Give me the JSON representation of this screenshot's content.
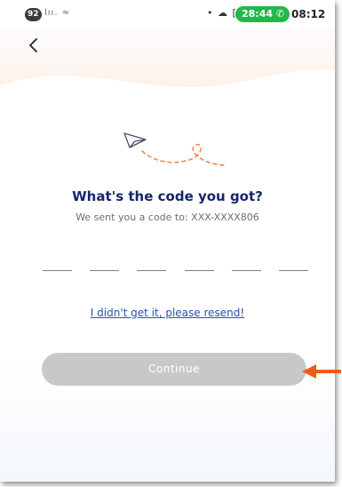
{
  "status_bar": {
    "badge": "92",
    "left_icons": "lıı. ≈",
    "right_icons": "• ☁ [o]",
    "call_timer": "28:44 ✆",
    "time": "08:12"
  },
  "icons": {
    "back": "chevron-left-icon",
    "illustration": "paper-plane-icon",
    "pointer": "arrow-left-icon"
  },
  "verification": {
    "title": "What's the code you got?",
    "subtitle": "We sent you a code to: XXX-XXXX806",
    "code_length": 6,
    "code_values": [
      "",
      "",
      "",
      "",
      "",
      ""
    ],
    "resend_label": "I didn't get it, please resend!",
    "continue_label": "Continue"
  },
  "colors": {
    "title": "#16266b",
    "link": "#2452b3",
    "button_disabled": "#c8c8c8",
    "call_pill": "#21b84a",
    "dashed_path": "#f08a4b",
    "pointer_arrow": "#f05a1a"
  }
}
